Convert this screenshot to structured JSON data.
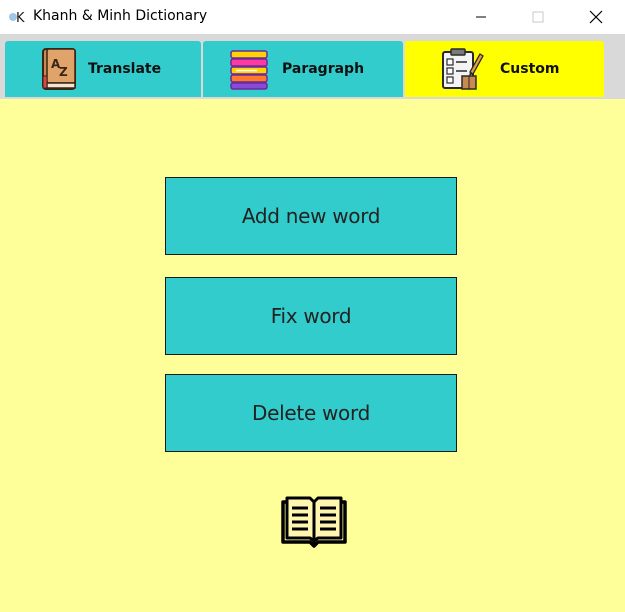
{
  "window": {
    "title": "Khanh & Minh Dictionary",
    "icon": "k-app-icon",
    "controls": [
      "minimize-icon",
      "maximize-icon",
      "close-icon"
    ]
  },
  "tabs": [
    {
      "label": "Translate",
      "icon": "dictionary-book-icon",
      "color": "#33cccc",
      "selected": false
    },
    {
      "label": "Paragraph",
      "icon": "paragraph-stack-icon",
      "color": "#33cccc",
      "selected": false
    },
    {
      "label": "Custom",
      "icon": "checklist-pencil-icon",
      "color": "#ffff00",
      "selected": true
    }
  ],
  "custom": {
    "background": "#ffff99",
    "buttons": {
      "add": "Add new word",
      "fix": "Fix word",
      "delete": "Delete word"
    },
    "button_color": "#33cccc",
    "footer_icon": "open-book-icon"
  }
}
